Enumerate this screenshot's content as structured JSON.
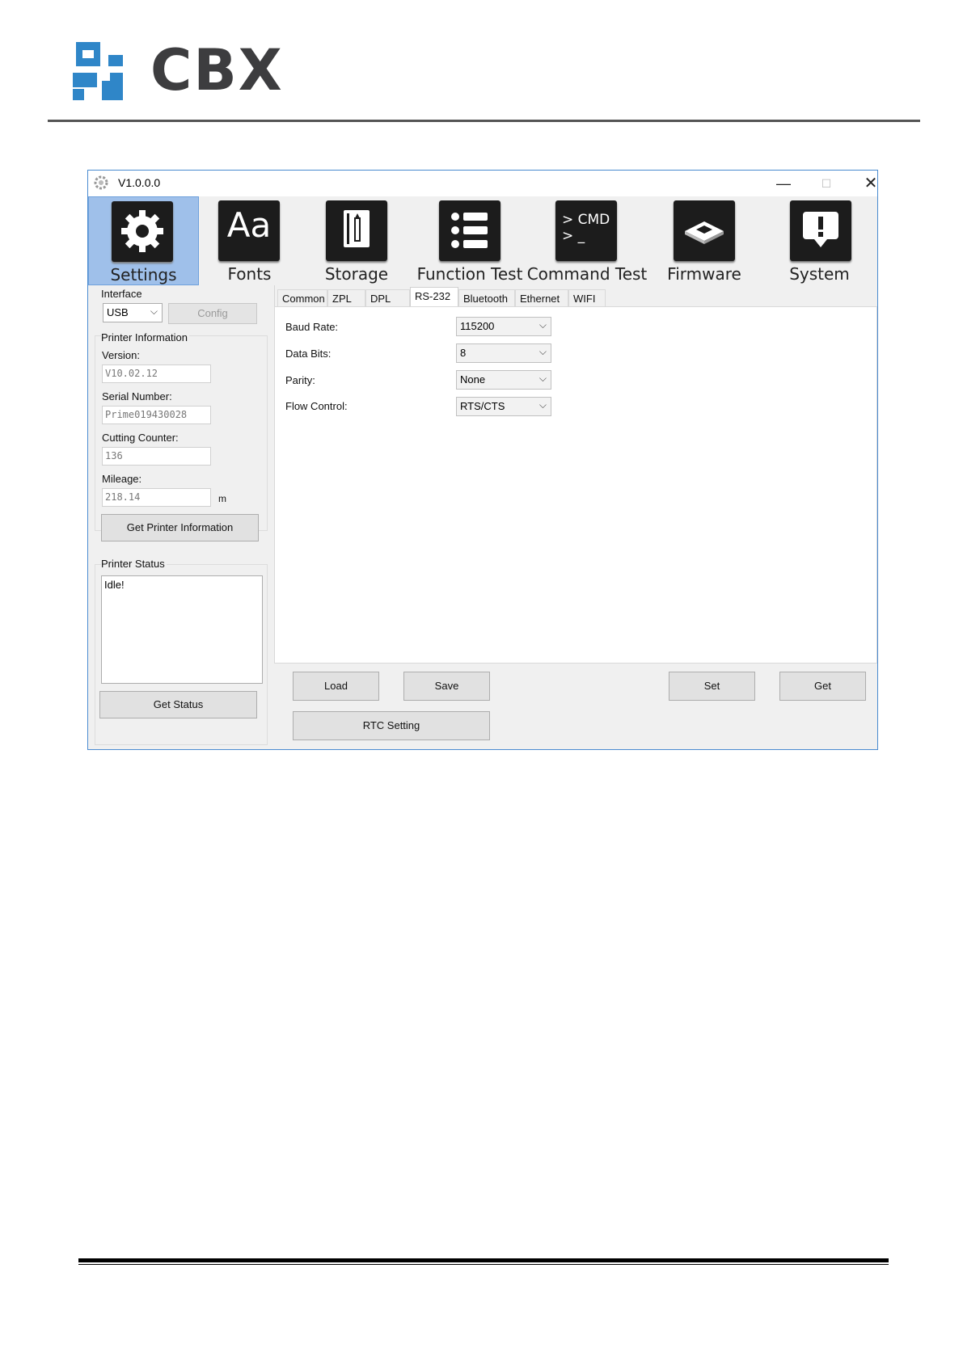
{
  "brand": {
    "wordmark": "CBX",
    "accent": "#2f86c8"
  },
  "window": {
    "title": "V1.0.0.0",
    "controls": {
      "minimize": "—",
      "maximize": "☐",
      "close": "✕"
    }
  },
  "toolbar": {
    "items": [
      {
        "label": "Settings",
        "icon": "gear-icon",
        "active": true
      },
      {
        "label": "Fonts",
        "icon": "fonts-icon",
        "glyph": "Aa"
      },
      {
        "label": "Storage",
        "icon": "storage-icon"
      },
      {
        "label": "Function Test",
        "icon": "list-icon"
      },
      {
        "label": "Command Test",
        "icon": "cmd-icon",
        "glyph": "> CMD\n> _"
      },
      {
        "label": "Firmware",
        "icon": "chip-icon"
      },
      {
        "label": "System",
        "icon": "alert-icon"
      }
    ]
  },
  "left": {
    "interface_label": "Interface",
    "interface_value": "USB",
    "config_button": "Config",
    "printer_info_label": "Printer Information",
    "version_label": "Version:",
    "version_value": "V10.02.12",
    "serial_label": "Serial Number:",
    "serial_value": "Prime019430028",
    "cutting_label": "Cutting Counter:",
    "cutting_value": "136",
    "mileage_label": "Mileage:",
    "mileage_value": "218.14",
    "mileage_unit": "m",
    "get_info_button": "Get Printer Information",
    "status_label": "Printer Status",
    "status_value": "Idle!",
    "get_status_button": "Get Status"
  },
  "tabs": [
    "Common",
    "ZPL",
    "DPL",
    "RS-232",
    "Bluetooth",
    "Ethernet",
    "WIFI"
  ],
  "active_tab": "RS-232",
  "rs232": {
    "baud_label": "Baud Rate:",
    "baud_value": "115200",
    "data_bits_label": "Data Bits:",
    "data_bits_value": "8",
    "parity_label": "Parity:",
    "parity_value": "None",
    "flow_label": "Flow Control:",
    "flow_value": "RTS/CTS"
  },
  "actions": {
    "load": "Load",
    "save": "Save",
    "set": "Set",
    "get": "Get",
    "rtc": "RTC Setting"
  }
}
